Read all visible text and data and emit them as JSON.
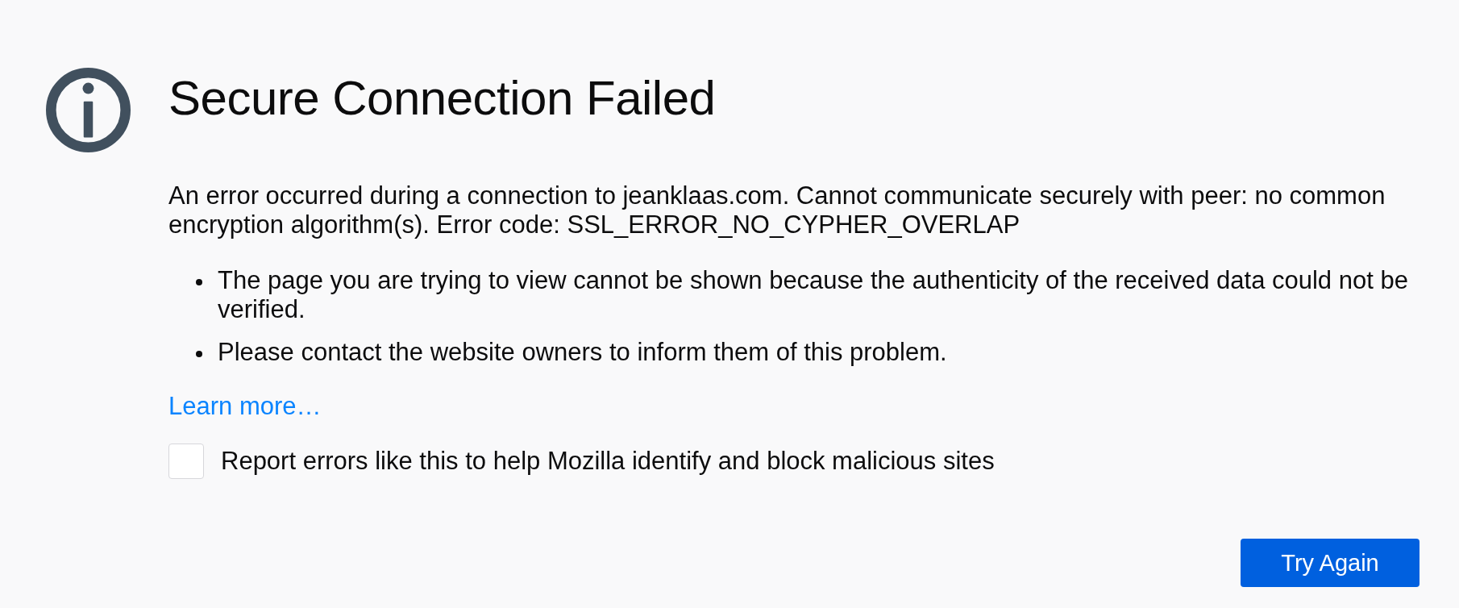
{
  "page": {
    "title": "Secure Connection Failed",
    "description": "An error occurred during a connection to jeanklaas.com. Cannot communicate securely with peer: no common encryption algorithm(s). Error code: SSL_ERROR_NO_CYPHER_OVERLAP",
    "bullets": [
      "The page you are trying to view cannot be shown because the authenticity of the received data could not be verified.",
      "Please contact the website owners to inform them of this problem."
    ],
    "learn_more_link": "Learn more…",
    "report_checkbox": {
      "label": "Report errors like this to help Mozilla identify and block malicious sites",
      "checked": false
    },
    "try_again_button": "Try Again"
  }
}
